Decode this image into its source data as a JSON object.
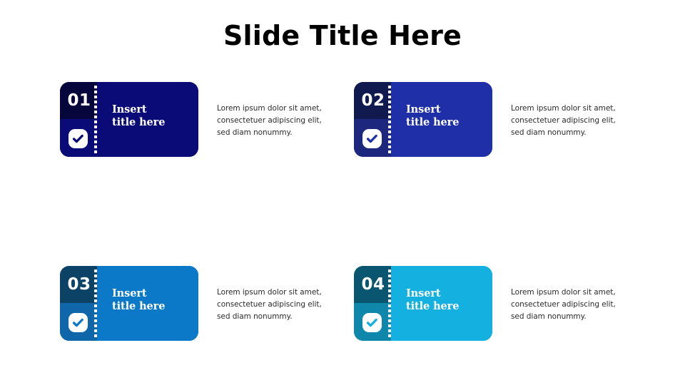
{
  "slide": {
    "title": "Slide Title Here",
    "background": "#ffffff",
    "title_color": "#000000"
  },
  "icons": {
    "check": "check-circle-icon",
    "perforation": "perforation-dots"
  },
  "items": [
    {
      "number": "01",
      "title_line1": "Insert",
      "title_line2": "title here",
      "description": "Lorem ipsum dolor sit amet, consectetuer adipiscing elit, sed diam nonummy.",
      "colors": {
        "body": "#0b0b78",
        "stub_top": "#06063c",
        "stub_bottom": "#0b0b78",
        "check_bg": "#ffffff",
        "check_mark": "#0b0b78"
      }
    },
    {
      "number": "02",
      "title_line1": "Insert",
      "title_line2": "title here",
      "description": "Lorem ipsum dolor sit amet, consectetuer adipiscing elit, sed diam nonummy.",
      "colors": {
        "body": "#1f2fa8",
        "stub_top": "#111a4f",
        "stub_bottom": "#1d277e",
        "check_bg": "#ffffff",
        "check_mark": "#1f2fa8"
      }
    },
    {
      "number": "03",
      "title_line1": "Insert",
      "title_line2": "title here",
      "description": "Lorem ipsum dolor sit amet, consectetuer adipiscing elit, sed diam nonummy.",
      "colors": {
        "body": "#0b79c8",
        "stub_top": "#0b4266",
        "stub_bottom": "#0f66a8",
        "check_bg": "#ffffff",
        "check_mark": "#0b79c8"
      }
    },
    {
      "number": "04",
      "title_line1": "Insert",
      "title_line2": "title here",
      "description": "Lorem ipsum dolor sit amet, consectetuer adipiscing elit, sed diam nonummy.",
      "colors": {
        "body": "#14b0e0",
        "stub_top": "#0a5570",
        "stub_bottom": "#0f87ab",
        "check_bg": "#ffffff",
        "check_mark": "#14b0e0"
      }
    }
  ]
}
